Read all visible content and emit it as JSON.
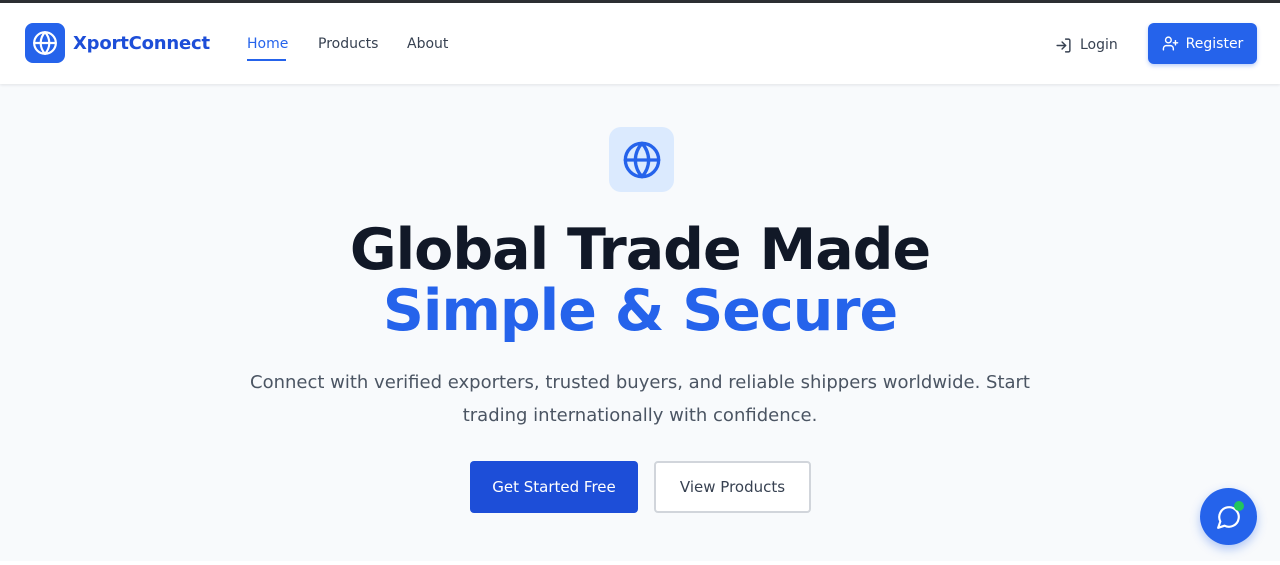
{
  "brand": {
    "name": "XportConnect",
    "icon": "globe-icon"
  },
  "nav": {
    "links": [
      {
        "label": "Home",
        "active": true
      },
      {
        "label": "Products",
        "active": false
      },
      {
        "label": "About",
        "active": false
      }
    ],
    "login_label": "Login",
    "login_icon": "login-icon",
    "register_label": "Register",
    "register_icon": "user-plus-icon"
  },
  "hero": {
    "icon": "globe-icon",
    "title_line1": "Global Trade Made",
    "title_line2": "Simple & Secure",
    "subtitle": "Connect with verified exporters, trusted buyers, and reliable shippers worldwide. Start trading internationally with confidence.",
    "primary_cta": "Get Started Free",
    "secondary_cta": "View Products"
  },
  "chat": {
    "icon": "chat-bubble-icon",
    "status": "online"
  },
  "colors": {
    "accent": "#2563eb",
    "title": "#111827",
    "body_text": "#4b5563",
    "background": "#f8fafc",
    "online_dot": "#22c55e"
  }
}
